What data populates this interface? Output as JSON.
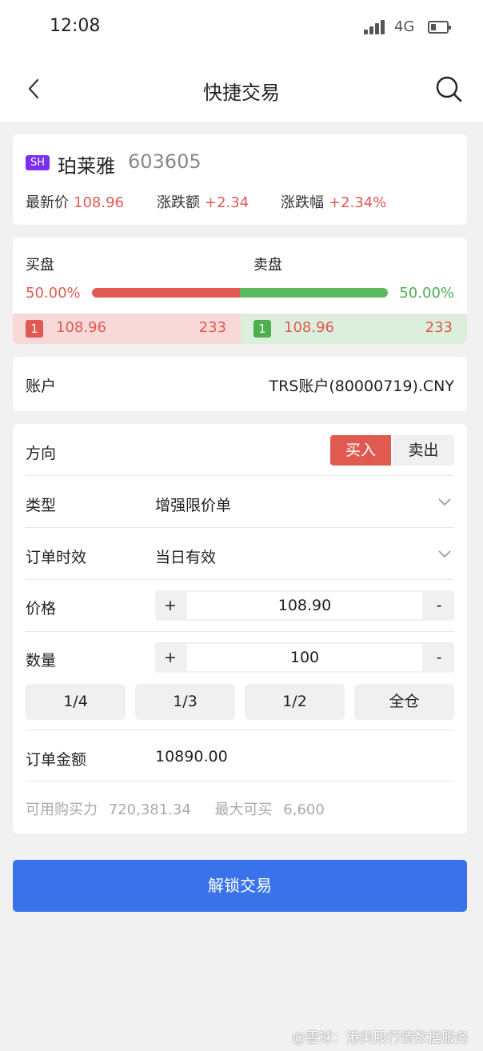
{
  "status_bar": {
    "time": "12:08",
    "network": "4G"
  },
  "nav": {
    "title": "快捷交易"
  },
  "stock": {
    "market": "SH",
    "name": "珀莱雅",
    "code": "603605",
    "last_price_label": "最新价",
    "last_price": "108.96",
    "change_label": "涨跌额",
    "change": "+2.34",
    "change_pct_label": "涨跌幅",
    "change_pct": "+2.34%"
  },
  "order_book": {
    "bid_label": "买盘",
    "ask_label": "卖盘",
    "bid_pct": "50.00%",
    "ask_pct": "50.00%",
    "bid_ratio": 0.5,
    "bid": {
      "level": "1",
      "price": "108.96",
      "volume": "233"
    },
    "ask": {
      "level": "1",
      "price": "108.96",
      "volume": "233"
    }
  },
  "account": {
    "label": "账户",
    "value": "TRS账户(80000719).CNY"
  },
  "order": {
    "direction_label": "方向",
    "buy": "买入",
    "sell": "卖出",
    "type_label": "类型",
    "type_value": "增强限价单",
    "validity_label": "订单时效",
    "validity_value": "当日有效",
    "price_label": "价格",
    "price_value": "108.90",
    "qty_label": "数量",
    "qty_value": "100",
    "plus": "+",
    "minus": "-",
    "fractions": [
      "1/4",
      "1/3",
      "1/2",
      "全仓"
    ],
    "amount_label": "订单金额",
    "amount_value": "10890.00",
    "buying_power_label": "可用购买力",
    "buying_power": "720,381.34",
    "max_buy_label": "最大可买",
    "max_buy": "6,600"
  },
  "unlock_button": "解锁交易",
  "watermark": "@雪球：港美股行情数据服务",
  "colors": {
    "up": "#e05a52",
    "down": "#4caf50",
    "primary": "#3a73e9",
    "badge": "#7b2ff2"
  }
}
